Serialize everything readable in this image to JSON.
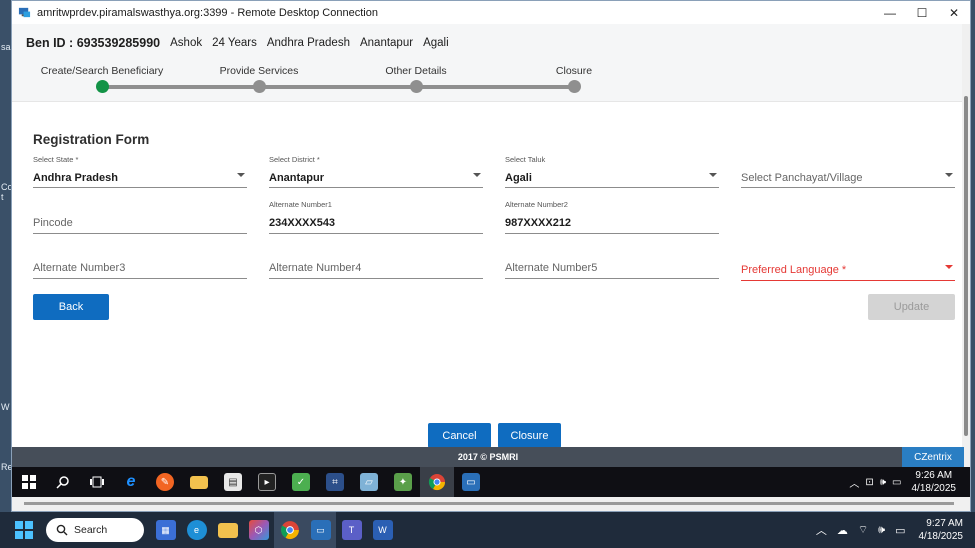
{
  "window": {
    "title": "amritwprdev.piramalswasthya.org:3399 - Remote Desktop Connection",
    "minimize_glyph": "—",
    "maximize_glyph": "☐",
    "close_glyph": "✕"
  },
  "desktop_edge": {
    "left_fragments": [
      "sa",
      "Con",
      "t",
      "W",
      "Re"
    ]
  },
  "beneficiary": {
    "ben_id": "Ben ID : 693539285990",
    "name": "Ashok",
    "age": "24 Years",
    "state": "Andhra Pradesh",
    "district": "Anantapur",
    "taluk": "Agali"
  },
  "stepper": {
    "steps": [
      {
        "label": "Create/Search Beneficiary",
        "state": "active"
      },
      {
        "label": "Provide Services",
        "state": "inactive"
      },
      {
        "label": "Other Details",
        "state": "inactive"
      },
      {
        "label": "Closure",
        "state": "inactive"
      }
    ],
    "active_color": "#139347",
    "inactive_color": "#8f8f8f"
  },
  "form": {
    "title": "Registration Form",
    "state": {
      "label": "Select State *",
      "value": "Andhra Pradesh"
    },
    "district": {
      "label": "Select District *",
      "value": "Anantapur"
    },
    "taluk": {
      "label": "Select Taluk",
      "value": "Agali"
    },
    "panchayat": {
      "placeholder": "Select Panchayat/Village"
    },
    "pincode": {
      "placeholder": "Pincode"
    },
    "alt1": {
      "label": "Alternate Number1",
      "value": "234XXXX543"
    },
    "alt2": {
      "label": "Alternate Number2",
      "value": "987XXXX212"
    },
    "alt3": {
      "placeholder": "Alternate Number3"
    },
    "alt4": {
      "placeholder": "Alternate Number4"
    },
    "alt5": {
      "placeholder": "Alternate Number5"
    },
    "language": {
      "placeholder": "Preferred Language *"
    },
    "back_label": "Back",
    "update_label": "Update"
  },
  "actions": {
    "cancel_label": "Cancel",
    "closure_label": "Closure"
  },
  "footer": {
    "copyright": "2017 © PSMRI",
    "brand": "CZentrix"
  },
  "remote_taskbar": {
    "icons": [
      "windows-start-icon",
      "search-icon",
      "task-view-icon",
      "ie-icon",
      "orange-app-icon",
      "folder-icon",
      "app-window-icon",
      "terminal-icon",
      "editor-icon",
      "network-icon",
      "tablet-icon",
      "puzzle-icon",
      "chrome-icon",
      "remote-desktop-icon"
    ],
    "time": "9:26 AM",
    "date": "4/18/2025"
  },
  "host_taskbar": {
    "search_label": "Search",
    "time": "9:27 AM",
    "date": "4/18/2025"
  },
  "colors": {
    "primary_button": "#0f6cc0",
    "disabled_button": "#d4d4d4",
    "required_red": "#e53935",
    "footer_bg": "#464e59",
    "brand_bg": "#2a7ec3"
  }
}
